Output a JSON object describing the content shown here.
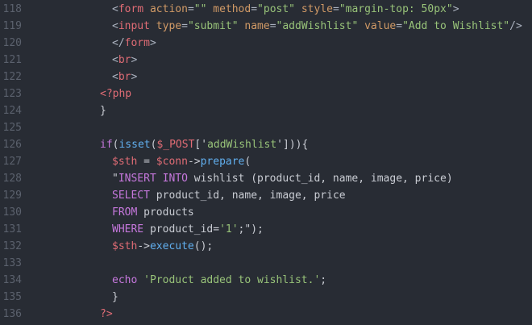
{
  "editor": {
    "colors": {
      "background": "#282c34",
      "line_number": "#5b616d",
      "default": "#c9ccd3",
      "tag": "#e06c75",
      "attribute": "#d19a66",
      "string": "#98c379",
      "variable": "#e06c75",
      "function": "#61afef",
      "keyword": "#c678dd"
    },
    "lines": [
      {
        "n": "118",
        "indent": 2,
        "tokens": [
          {
            "t": "<",
            "c": "punct"
          },
          {
            "t": "form",
            "c": "tag"
          },
          {
            "t": " ",
            "c": "plain"
          },
          {
            "t": "action",
            "c": "attr"
          },
          {
            "t": "=",
            "c": "punct"
          },
          {
            "t": "\"\"",
            "c": "str"
          },
          {
            "t": " ",
            "c": "plain"
          },
          {
            "t": "method",
            "c": "attr"
          },
          {
            "t": "=",
            "c": "punct"
          },
          {
            "t": "\"post\"",
            "c": "str"
          },
          {
            "t": " ",
            "c": "plain"
          },
          {
            "t": "style",
            "c": "attr"
          },
          {
            "t": "=",
            "c": "punct"
          },
          {
            "t": "\"margin-top: 50px\"",
            "c": "str"
          },
          {
            "t": ">",
            "c": "punct"
          }
        ]
      },
      {
        "n": "119",
        "indent": 2,
        "tokens": [
          {
            "t": "<",
            "c": "punct"
          },
          {
            "t": "input",
            "c": "tag"
          },
          {
            "t": " ",
            "c": "plain"
          },
          {
            "t": "type",
            "c": "attr"
          },
          {
            "t": "=",
            "c": "punct"
          },
          {
            "t": "\"submit\"",
            "c": "str"
          },
          {
            "t": " ",
            "c": "plain"
          },
          {
            "t": "name",
            "c": "attr"
          },
          {
            "t": "=",
            "c": "punct"
          },
          {
            "t": "\"addWishlist\"",
            "c": "str"
          },
          {
            "t": " ",
            "c": "plain"
          },
          {
            "t": "value",
            "c": "attr"
          },
          {
            "t": "=",
            "c": "punct"
          },
          {
            "t": "\"Add to Wishlist\"",
            "c": "str"
          },
          {
            "t": "/>",
            "c": "punct"
          }
        ]
      },
      {
        "n": "120",
        "indent": 2,
        "tokens": [
          {
            "t": "</",
            "c": "punct"
          },
          {
            "t": "form",
            "c": "tag"
          },
          {
            "t": ">",
            "c": "punct"
          }
        ]
      },
      {
        "n": "121",
        "indent": 2,
        "tokens": [
          {
            "t": "<",
            "c": "punct"
          },
          {
            "t": "br",
            "c": "tag"
          },
          {
            "t": ">",
            "c": "punct"
          }
        ]
      },
      {
        "n": "122",
        "indent": 2,
        "tokens": [
          {
            "t": "<",
            "c": "punct"
          },
          {
            "t": "br",
            "c": "tag"
          },
          {
            "t": ">",
            "c": "punct"
          }
        ]
      },
      {
        "n": "123",
        "indent": 1,
        "tokens": [
          {
            "t": "<?php",
            "c": "php"
          }
        ]
      },
      {
        "n": "124",
        "indent": 1,
        "tokens": [
          {
            "t": "}",
            "c": "default"
          }
        ]
      },
      {
        "n": "125",
        "indent": 0,
        "tokens": []
      },
      {
        "n": "126",
        "indent": 1,
        "tokens": [
          {
            "t": "if",
            "c": "kw"
          },
          {
            "t": "(",
            "c": "default"
          },
          {
            "t": "isset",
            "c": "fn"
          },
          {
            "t": "(",
            "c": "default"
          },
          {
            "t": "$_POST",
            "c": "var"
          },
          {
            "t": "['",
            "c": "default"
          },
          {
            "t": "addWishlist",
            "c": "str"
          },
          {
            "t": "'])){",
            "c": "default"
          }
        ]
      },
      {
        "n": "127",
        "indent": 2,
        "tokens": [
          {
            "t": "$sth",
            "c": "var"
          },
          {
            "t": " = ",
            "c": "default"
          },
          {
            "t": "$conn",
            "c": "var"
          },
          {
            "t": "->",
            "c": "default"
          },
          {
            "t": "prepare",
            "c": "fn"
          },
          {
            "t": "(",
            "c": "default"
          }
        ]
      },
      {
        "n": "128",
        "indent": 2,
        "tokens": [
          {
            "t": "\"",
            "c": "default"
          },
          {
            "t": "INSERT INTO",
            "c": "kw"
          },
          {
            "t": " wishlist (product_id, name, image, price)",
            "c": "default"
          }
        ]
      },
      {
        "n": "129",
        "indent": 2,
        "tokens": [
          {
            "t": "SELECT",
            "c": "kw"
          },
          {
            "t": " product_id, name, image, price",
            "c": "default"
          }
        ]
      },
      {
        "n": "130",
        "indent": 2,
        "tokens": [
          {
            "t": "FROM",
            "c": "kw"
          },
          {
            "t": " products",
            "c": "default"
          }
        ]
      },
      {
        "n": "131",
        "indent": 2,
        "tokens": [
          {
            "t": "WHERE",
            "c": "kw"
          },
          {
            "t": " product_id=",
            "c": "default"
          },
          {
            "t": "'1'",
            "c": "str"
          },
          {
            "t": ";\");",
            "c": "default"
          }
        ]
      },
      {
        "n": "132",
        "indent": 2,
        "tokens": [
          {
            "t": "$sth",
            "c": "var"
          },
          {
            "t": "->",
            "c": "default"
          },
          {
            "t": "execute",
            "c": "fn"
          },
          {
            "t": "();",
            "c": "default"
          }
        ]
      },
      {
        "n": "133",
        "indent": 0,
        "tokens": []
      },
      {
        "n": "134",
        "indent": 2,
        "tokens": [
          {
            "t": "echo",
            "c": "kw"
          },
          {
            "t": " ",
            "c": "plain"
          },
          {
            "t": "'Product added to wishlist.'",
            "c": "str"
          },
          {
            "t": ";",
            "c": "default"
          }
        ]
      },
      {
        "n": "135",
        "indent": 2,
        "tokens": [
          {
            "t": "}",
            "c": "default"
          }
        ]
      },
      {
        "n": "136",
        "indent": 1,
        "tokens": [
          {
            "t": "?>",
            "c": "php"
          }
        ]
      }
    ]
  }
}
